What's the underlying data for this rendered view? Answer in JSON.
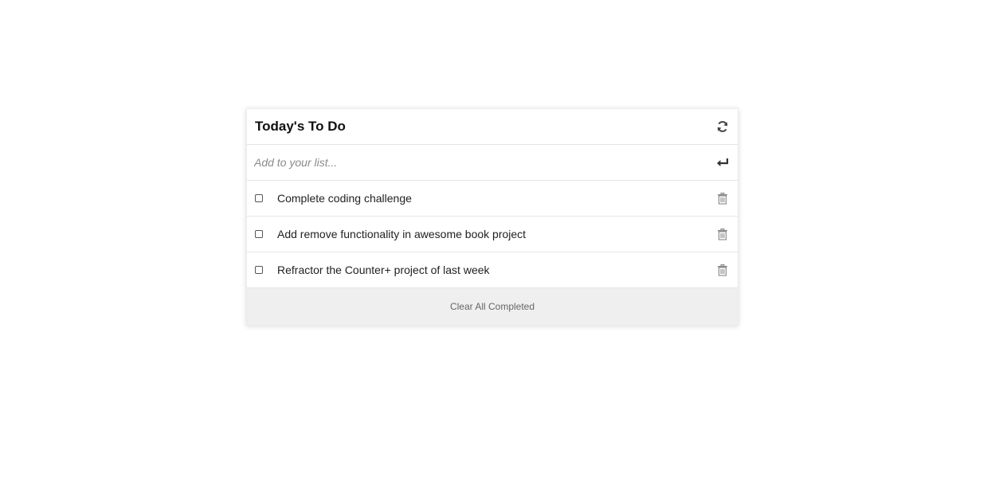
{
  "todo": {
    "title": "Today's To Do",
    "refresh_icon": "refresh-icon",
    "add_placeholder": "Add to your list...",
    "add_value": "",
    "enter_icon": "enter-icon",
    "tasks": [
      {
        "label": "Complete coding challenge",
        "completed": false,
        "delete_icon": "trash-icon"
      },
      {
        "label": "Add remove functionality in awesome book project",
        "completed": false,
        "delete_icon": "trash-icon"
      },
      {
        "label": "Refractor the Counter+ project of last week",
        "completed": false,
        "delete_icon": "trash-icon"
      }
    ],
    "clear_label": "Clear All Completed"
  }
}
